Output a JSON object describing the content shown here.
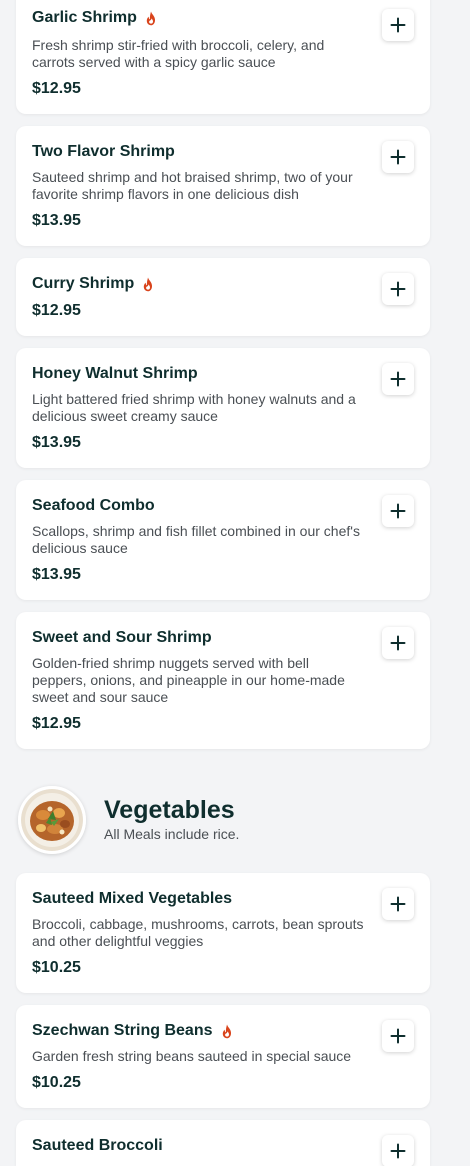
{
  "items_top": [
    {
      "name": "Garlic Shrimp",
      "spicy": true,
      "description": "Fresh shrimp stir-fried with broccoli, celery, and carrots served with a spicy garlic sauce",
      "price": "$12.95"
    },
    {
      "name": "Two Flavor Shrimp",
      "spicy": false,
      "description": "Sauteed shrimp and hot braised shrimp, two of your favorite shrimp flavors in one delicious dish",
      "price": "$13.95"
    },
    {
      "name": "Curry Shrimp",
      "spicy": true,
      "description": "",
      "price": "$12.95"
    },
    {
      "name": "Honey Walnut Shrimp",
      "spicy": false,
      "description": "Light battered fried shrimp with honey walnuts and a delicious sweet creamy sauce",
      "price": "$13.95"
    },
    {
      "name": "Seafood Combo",
      "spicy": false,
      "description": "Scallops, shrimp and fish fillet combined in our chef's delicious sauce",
      "price": "$13.95"
    },
    {
      "name": "Sweet and Sour Shrimp",
      "spicy": false,
      "description": "Golden-fried shrimp nuggets served with bell peppers, onions, and pineapple in our home-made sweet and sour sauce",
      "price": "$12.95"
    }
  ],
  "vegetables_section": {
    "title": "Vegetables",
    "subtitle": "All Meals include rice."
  },
  "items_vegetables": [
    {
      "name": "Sauteed Mixed Vegetables",
      "spicy": false,
      "description": "Broccoli, cabbage, mushrooms, carrots, bean sprouts and other delightful veggies",
      "price": "$10.25"
    },
    {
      "name": "Szechwan String Beans",
      "spicy": true,
      "description": "Garden fresh string beans sauteed in special sauce",
      "price": "$10.25"
    },
    {
      "name": "Sauteed Broccoli",
      "spicy": false,
      "description": "",
      "price": ""
    }
  ],
  "colors": {
    "background": "#f3f4f6",
    "card": "#ffffff",
    "text_dark": "#0f2e2e",
    "text_muted": "#4a4f54",
    "spicy": "#d9441c"
  },
  "icons": {
    "spicy": "flame-icon",
    "add": "plus-icon"
  }
}
